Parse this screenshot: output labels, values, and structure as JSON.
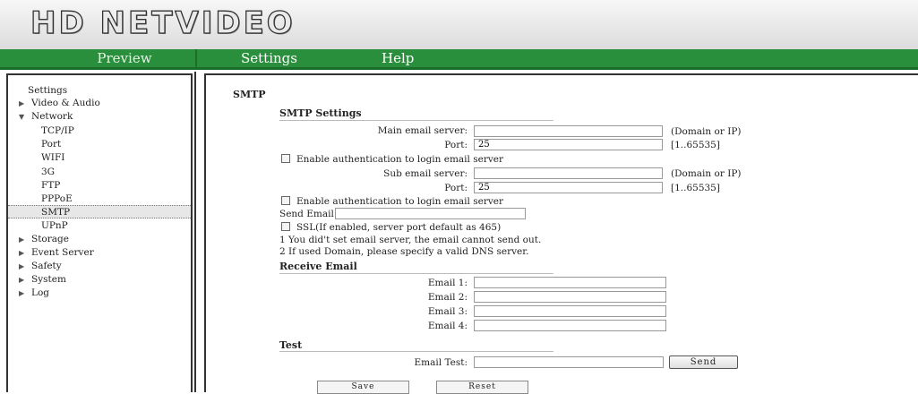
{
  "logo": "HD NETVIDEO",
  "nav": {
    "preview": "Preview",
    "settings": "Settings",
    "help": "Help"
  },
  "sidebar": {
    "root": "Settings",
    "items": [
      {
        "label": "Video & Audio"
      },
      {
        "label": "Network"
      },
      {
        "label": "TCP/IP"
      },
      {
        "label": "Port"
      },
      {
        "label": "WIFI"
      },
      {
        "label": "3G"
      },
      {
        "label": "FTP"
      },
      {
        "label": "PPPoE"
      },
      {
        "label": "SMTP"
      },
      {
        "label": "UPnP"
      },
      {
        "label": "Storage"
      },
      {
        "label": "Event Server"
      },
      {
        "label": "Safety"
      },
      {
        "label": "System"
      },
      {
        "label": "Log"
      }
    ]
  },
  "page": {
    "title": "SMTP"
  },
  "smtp": {
    "section_title": "SMTP Settings",
    "main_server_label": "Main email server:",
    "main_server_value": "",
    "main_server_hint": "(Domain or IP)",
    "port_label": "Port:",
    "port_value": "25",
    "port_hint": "[1..65535]",
    "auth_label": "Enable authentication to login email server",
    "sub_server_label": "Sub email server:",
    "sub_server_value": "",
    "sub_server_hint": "(Domain or IP)",
    "sub_port_label": "Port:",
    "sub_port_value": "25",
    "sub_port_hint": "[1..65535]",
    "sub_auth_label": "Enable authentication to login email server",
    "send_email_label": "Send Email:",
    "send_email_value": "",
    "ssl_label": "SSL(If enabled, server port default as 465)",
    "note1": "1 You did't set email server, the email cannot send out.",
    "note2": "2 If used Domain, please specify a valid DNS server."
  },
  "receive": {
    "section_title": "Receive Email",
    "email1_label": "Email 1:",
    "email2_label": "Email 2:",
    "email3_label": "Email 3:",
    "email4_label": "Email 4:",
    "email1_value": "",
    "email2_value": "",
    "email3_value": "",
    "email4_value": ""
  },
  "test": {
    "section_title": "Test",
    "email_test_label": "Email Test:",
    "email_test_value": "",
    "send_label": "Send"
  },
  "actions": {
    "save_label": "Save",
    "reset_label": "Reset"
  }
}
